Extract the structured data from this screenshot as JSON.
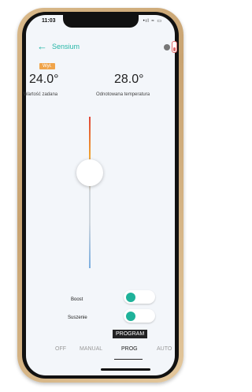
{
  "status": {
    "time": "11:03",
    "icons": "•ıl ≈ ▭"
  },
  "header": {
    "title": "Sensium"
  },
  "heating": {
    "badge": "Wył.",
    "set_temperature": "24.0°",
    "set_label": "Wartość zadana",
    "measured_temperature": "28.0°",
    "measured_label": "Odnotowana temperatura",
    "slider_level": 0.37
  },
  "toggles": [
    {
      "label": "Boost",
      "on": false
    },
    {
      "label": "Suszenie",
      "on": false
    }
  ],
  "tooltip": "PROGRAM",
  "modes": [
    {
      "label": "OFF",
      "active": false
    },
    {
      "label": "MANUAL",
      "active": false
    },
    {
      "label": "PROG",
      "active": true
    },
    {
      "label": "AUTO",
      "active": false
    }
  ],
  "colors": {
    "accent": "#27b7a8",
    "badge": "#f0a44a",
    "toggle_knob": "#1fb29a"
  }
}
